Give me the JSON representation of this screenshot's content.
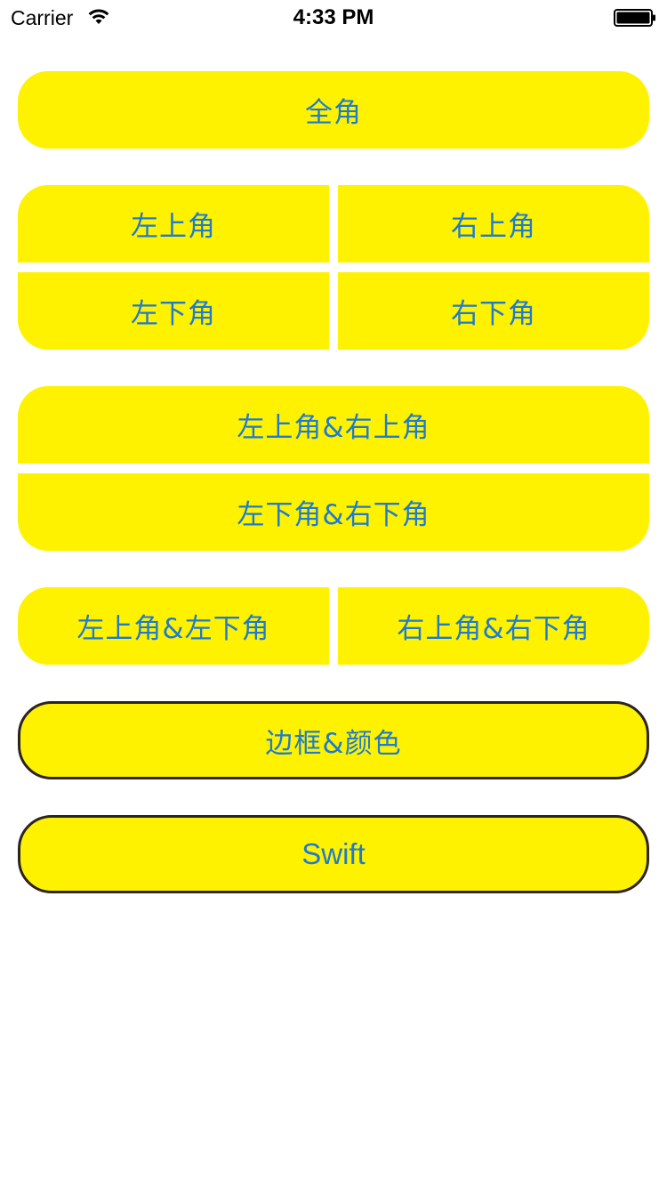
{
  "status_bar": {
    "carrier": "Carrier",
    "time": "4:33 PM",
    "wifi_icon": "wifi-icon",
    "battery_icon": "battery-full-icon"
  },
  "colors": {
    "button_fill": "#fff200",
    "button_text": "#1d7bd1",
    "border": "#2b2422",
    "background": "#ffffff"
  },
  "buttons": {
    "all_corners": "全角",
    "top_left": "左上角",
    "top_right": "右上角",
    "bottom_left": "左下角",
    "bottom_right": "右下角",
    "top_left_top_right": "左上角&右上角",
    "bottom_left_bottom_right": "左下角&右下角",
    "top_left_bottom_left": "左上角&左下角",
    "top_right_bottom_right": "右上角&右下角",
    "border_color": "边框&颜色",
    "swift": "Swift"
  }
}
